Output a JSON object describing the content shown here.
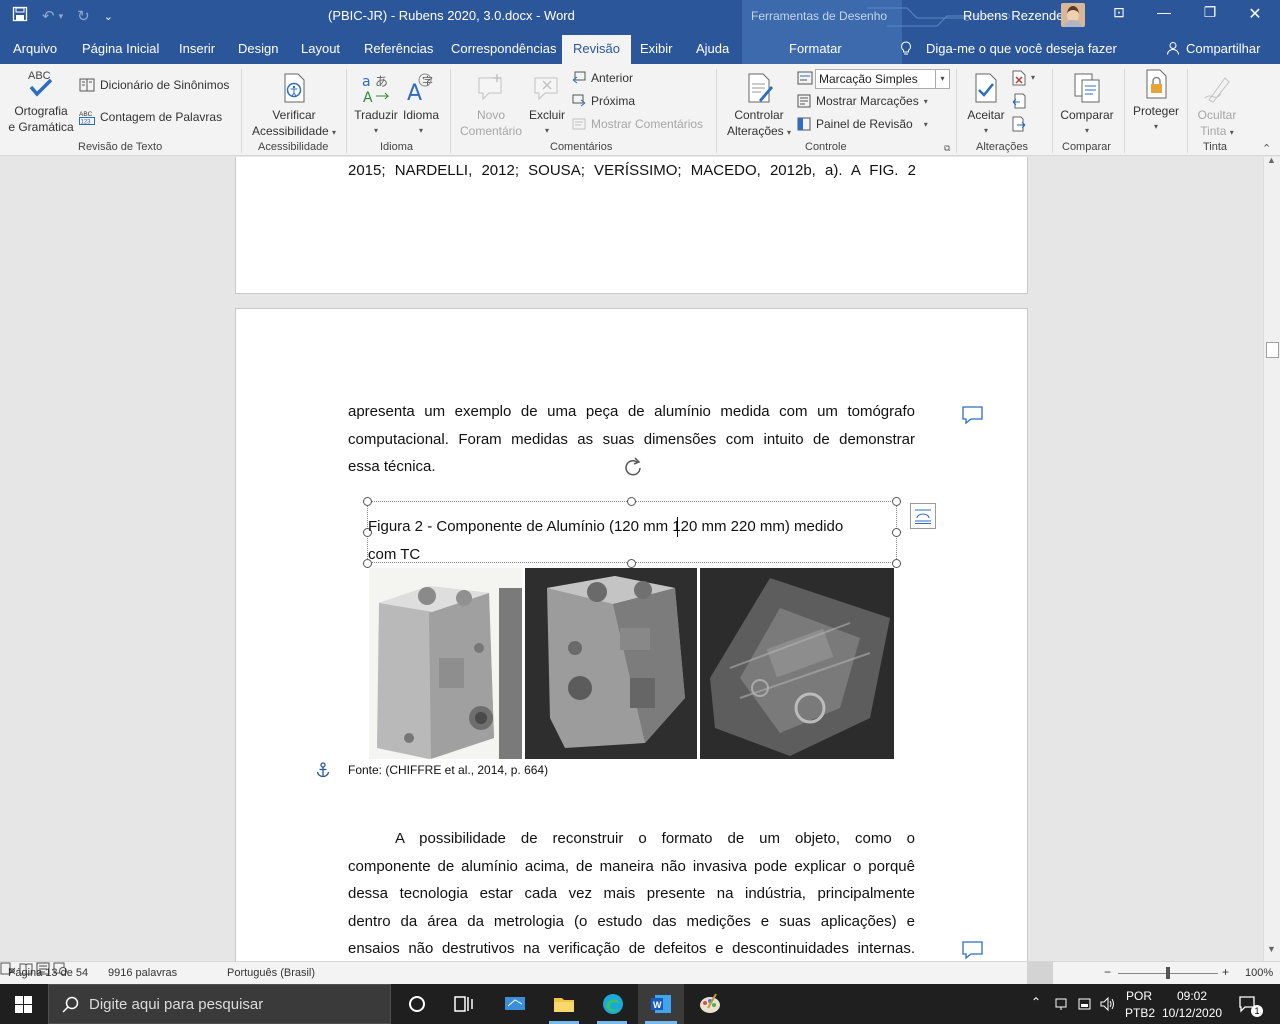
{
  "titlebar": {
    "doc_title": "(PBIC-JR) - Rubens 2020, 3.0.docx  -  Word",
    "context": "Ferramentas de Desenho",
    "user": "Rubens Rezende"
  },
  "tabs": [
    "Arquivo",
    "Página Inicial",
    "Inserir",
    "Design",
    "Layout",
    "Referências",
    "Correspondências",
    "Revisão",
    "Exibir",
    "Ajuda"
  ],
  "format_tab": "Formatar",
  "tell_me": "Diga-me o que você deseja fazer",
  "share": "Compartilhar",
  "ribbon": {
    "spelling_l1": "Ortografia",
    "spelling_l2": "e Gramática",
    "thesaurus": "Dicionário de Sinônimos",
    "wordcount": "Contagem de Palavras",
    "group_proofing": "Revisão de Texto",
    "check_access_l1": "Verificar",
    "check_access_l2": "Acessibilidade",
    "group_access": "Acessibilidade",
    "translate": "Traduzir",
    "language": "Idioma",
    "group_language": "Idioma",
    "new_comment_l1": "Novo",
    "new_comment_l2": "Comentário",
    "delete": "Excluir",
    "previous": "Anterior",
    "next": "Próxima",
    "show_comments": "Mostrar Comentários",
    "group_comments": "Comentários",
    "track_l1": "Controlar",
    "track_l2": "Alterações",
    "markup_select": "Marcação Simples",
    "show_markup": "Mostrar Marcações",
    "review_pane": "Painel de Revisão",
    "group_tracking": "Controle",
    "accept": "Aceitar",
    "group_changes": "Alterações",
    "compare": "Comparar",
    "group_compare": "Comparar",
    "protect": "Proteger",
    "hide_ink_l1": "Ocultar",
    "hide_ink_l2": "Tinta",
    "group_ink": "Tinta"
  },
  "document": {
    "top_line": "2015; NARDELLI, 2012; SOUSA; VERÍSSIMO; MACEDO, 2012b, a). A FIG. 2",
    "para1": [
      "apresenta um exemplo de uma peça de alumínio medida com um tomógrafo",
      "computacional. Foram medidas as suas dimensões com intuito de demonstrar",
      "essa técnica."
    ],
    "caption_l1": "Figura 2 - Componente de Alumínio (120 mm   120 mm   220 mm) medido",
    "caption_l2": "com TC",
    "source": "Fonte: (CHIFFRE et al., 2014, p. 664)",
    "para2": [
      "A possibilidade de reconstruir o formato de um objeto, como o",
      "componente de alumínio acima, de maneira não invasiva pode explicar o porquê",
      "dessa tecnologia estar cada vez mais presente na indústria, principalmente",
      "dentro da área da metrologia (o estudo das medições e suas aplicações) e",
      "ensaios não destrutivos na verificação de defeitos e descontinuidades internas."
    ]
  },
  "statusbar": {
    "page": "Página 13 de 54",
    "words": "9916 palavras",
    "language": "Português (Brasil)",
    "zoom": "100%"
  },
  "taskbar": {
    "search_placeholder": "Digite aqui para pesquisar",
    "lang_l1": "POR",
    "lang_l2": "PTB2",
    "time": "09:02",
    "date": "10/12/2020",
    "notif_count": "1"
  },
  "colors": {
    "word_blue": "#2b579a",
    "context_blue": "#3c6aad"
  }
}
